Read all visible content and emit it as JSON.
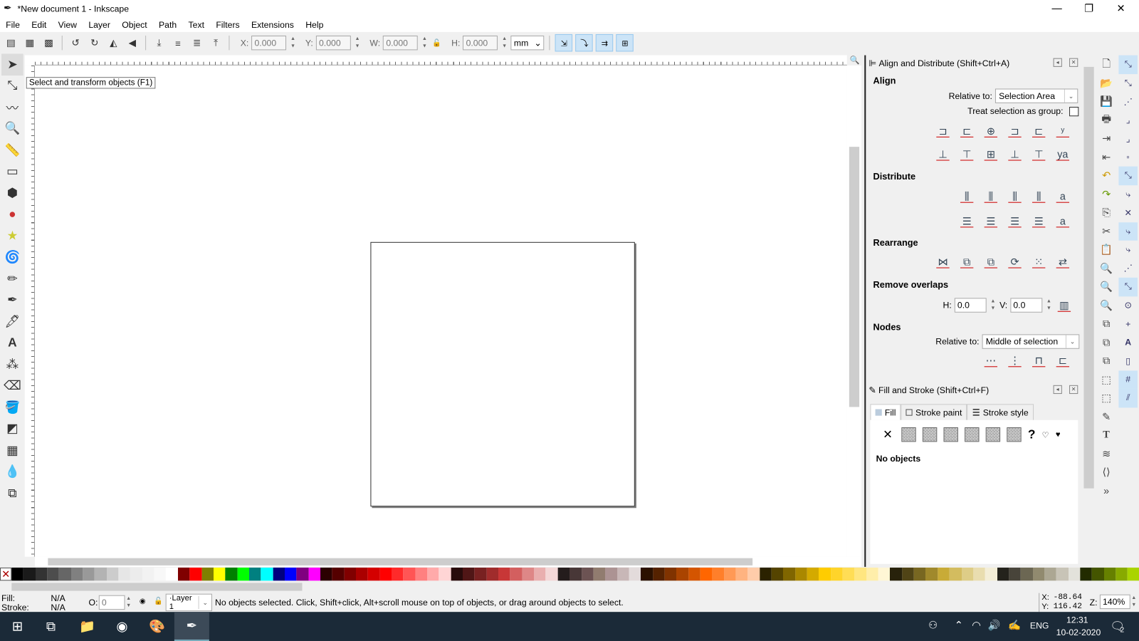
{
  "window": {
    "title": "*New document 1 - Inkscape",
    "minimize": "—",
    "restore": "❐",
    "close": "✕"
  },
  "menu": [
    "File",
    "Edit",
    "View",
    "Layer",
    "Object",
    "Path",
    "Text",
    "Filters",
    "Extensions",
    "Help"
  ],
  "toolbar": {
    "x_label": "X:",
    "x": "0.000",
    "y_label": "Y:",
    "y": "0.000",
    "w_label": "W:",
    "w": "0.000",
    "h_label": "H:",
    "h": "0.000",
    "unit": "mm"
  },
  "tooltip": "Select and transform objects (F1)",
  "tools": [
    "selector",
    "node",
    "tweak",
    "zoom",
    "measure",
    "rectangle",
    "3d-box",
    "ellipse",
    "star",
    "spiral",
    "pencil",
    "pen",
    "calligraphy",
    "text",
    "spray",
    "eraser",
    "paint-bucket",
    "gradient",
    "mesh",
    "dropper",
    "connector"
  ],
  "align": {
    "title": "Align and Distribute (Shift+Ctrl+A)",
    "align_heading": "Align",
    "relative_label": "Relative to:",
    "relative_value": "Selection Area",
    "treat_group": "Treat selection as group:",
    "distribute_heading": "Distribute",
    "rearrange_heading": "Rearrange",
    "remove_overlaps_heading": "Remove overlaps",
    "h_label": "H:",
    "h_value": "0.0",
    "v_label": "V:",
    "v_value": "0.0",
    "nodes_heading": "Nodes",
    "nodes_relative_label": "Relative to:",
    "nodes_relative_value": "Middle of selection"
  },
  "fill_stroke": {
    "title": "Fill and Stroke (Shift+Ctrl+F)",
    "tabs": [
      "Fill",
      "Stroke paint",
      "Stroke style"
    ],
    "no_objects": "No objects"
  },
  "palette": [
    "#000000",
    "#1a1a1a",
    "#333333",
    "#4d4d4d",
    "#666666",
    "#808080",
    "#999999",
    "#b3b3b3",
    "#cccccc",
    "#e6e6e6",
    "#ececec",
    "#f2f2f2",
    "#f8f8f8",
    "#ffffff",
    "#800000",
    "#ff0000",
    "#808000",
    "#ffff00",
    "#008000",
    "#00ff00",
    "#008080",
    "#00ffff",
    "#000080",
    "#0000ff",
    "#800080",
    "#ff00ff",
    "#2b0000",
    "#550000",
    "#800000",
    "#aa0000",
    "#d40000",
    "#ff0000",
    "#ff2a2a",
    "#ff5555",
    "#ff8080",
    "#ffaaaa",
    "#ffd5d5",
    "#280b0b",
    "#501616",
    "#782121",
    "#a02c2c",
    "#c83737",
    "#d35f5f",
    "#de8787",
    "#e9afaf",
    "#f4d7d7",
    "#241c1c",
    "#483737",
    "#6c5353",
    "#917c6f",
    "#ac9393",
    "#c8b7b7",
    "#e3dbdb",
    "#2b1100",
    "#552200",
    "#803300",
    "#aa4400",
    "#d45500",
    "#ff6600",
    "#ff7f2a",
    "#ff9955",
    "#ffb380",
    "#ffccaa",
    "#2b2200",
    "#554400",
    "#806600",
    "#aa8800",
    "#d4aa00",
    "#ffcc00",
    "#ffd42a",
    "#ffdd55",
    "#ffe680",
    "#ffeeaa",
    "#fff6d5",
    "#28220b",
    "#504416",
    "#786721",
    "#a0892c",
    "#c8ab37",
    "#d3bc5f",
    "#decd87",
    "#e9ddaf",
    "#f4eed7",
    "#24221c",
    "#48443a",
    "#6c6753",
    "#918a6f",
    "#aca793",
    "#c8c4b7",
    "#e3e2db",
    "#222b00",
    "#445500",
    "#668000",
    "#88aa00",
    "#aad400"
  ],
  "status": {
    "fill_label": "Fill:",
    "fill_value": "N/A",
    "stroke_label": "Stroke:",
    "stroke_value": "N/A",
    "opacity_label": "O:",
    "opacity_value": "0",
    "layer": "·Layer 1",
    "message": "No objects selected. Click, Shift+click, Alt+scroll mouse on top of objects, or drag around objects to select.",
    "cursor_x_label": "X:",
    "cursor_x": "-88.64",
    "cursor_y_label": "Y:",
    "cursor_y": "116.42",
    "zoom_label": "Z:",
    "zoom": "140%"
  },
  "taskbar": {
    "lang": "ENG",
    "time": "12:31",
    "date": "10-02-2020",
    "notifications": "2"
  }
}
